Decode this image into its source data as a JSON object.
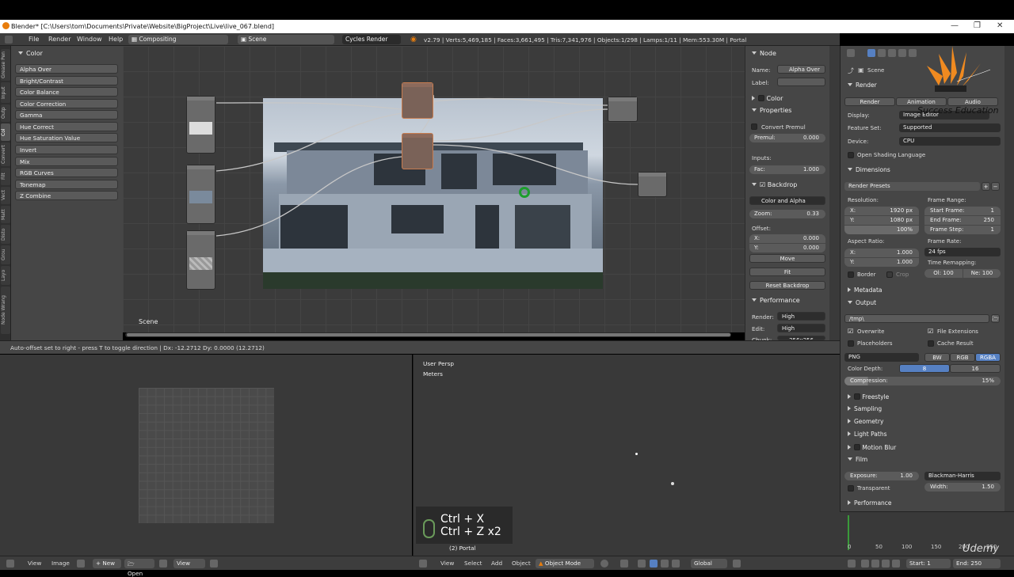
{
  "window": {
    "title": "Blender* [C:\\Users\\tom\\Documents\\Private\\Website\\BigProject\\Live\\live_067.blend]"
  },
  "mainmenu": {
    "items": [
      "File",
      "Render",
      "Window",
      "Help"
    ],
    "layout": "Compositing",
    "scene": "Scene",
    "engine": "Cycles Render",
    "stats": "v2.79 | Verts:5,469,185 | Faces:3,661,495 | Tris:7,341,976 | Objects:1/298 | Lamps:1/11 | Mem:553.30M | Portal"
  },
  "shelf": {
    "tabs": [
      "Grease Pen",
      "Input",
      "Outp",
      "Col",
      "Convert",
      "Filt",
      "Vect",
      "Matt",
      "Disto",
      "Grou",
      "Layo",
      "Node Wrang"
    ],
    "header": "Color",
    "buttons": [
      "Alpha Over",
      "Bright/Contrast",
      "Color Balance",
      "Color Correction",
      "Gamma",
      "Hue Correct",
      "Hue Saturation Value",
      "Invert",
      "Mix",
      "RGB Curves",
      "Tonemap",
      "Z Combine"
    ]
  },
  "nodeeditor": {
    "scene_label": "Scene"
  },
  "npanel": {
    "node_header": "Node",
    "name_label": "Name:",
    "name_value": "Alpha Over",
    "label_label": "Label:",
    "color_header": "Color",
    "properties_header": "Properties",
    "convert_premul": "Convert Premul",
    "premul": "Premul:",
    "premul_value": "0.000",
    "inputs": "Inputs:",
    "fac": "Fac:",
    "fac_value": "1.000",
    "backdrop_header": "Backdrop",
    "backdrop_mode": "Color and Alpha",
    "zoom": "Zoom:",
    "zoom_value": "0.33",
    "offset": "Offset:",
    "x": "X:",
    "x_value": "0.000",
    "y": "Y:",
    "y_value": "0.000",
    "move": "Move",
    "fit": "Fit",
    "reset": "Reset Backdrop",
    "performance_header": "Performance",
    "render": "Render:",
    "render_value": "High",
    "edit": "Edit:",
    "edit_value": "High",
    "chunk": "Chunk:",
    "chunk_value": "256x256"
  },
  "opstatus": {
    "text": "Auto-offset set to right - press T to toggle direction  |  Dx: -12.2712  Dy: 0.0000 (12.2712)"
  },
  "viewport": {
    "persp": "User Persp",
    "units": "Meters",
    "object": "(2) Portal"
  },
  "keys": {
    "line1": "Ctrl + X",
    "line2": "Ctrl + Z x2"
  },
  "bottombar": {
    "uv_items": [
      "View",
      "Image",
      "New",
      "Open",
      "View"
    ],
    "v3d_items": [
      "View",
      "Select",
      "Add",
      "Object"
    ],
    "mode": "Object Mode",
    "orientation": "Global"
  },
  "properties": {
    "scene": "Scene",
    "render_header": "Render",
    "render_btn": "Render",
    "animation_btn": "Animation",
    "audio_btn": "Audio",
    "display_label": "Display:",
    "display_value": "Image Editor",
    "feature_label": "Feature Set:",
    "feature_value": "Supported",
    "device_label": "Device:",
    "device_value": "CPU",
    "osl": "Open Shading Language",
    "dimensions_header": "Dimensions",
    "render_presets": "Render Presets",
    "resolution": "Resolution:",
    "res_x": "X:",
    "res_x_value": "1920 px",
    "res_y": "Y:",
    "res_y_value": "1080 px",
    "res_pct": "100%",
    "frame_range": "Frame Range:",
    "start_frame": "Start Frame:",
    "start_frame_value": "1",
    "end_frame": "End Frame:",
    "end_frame_value": "250",
    "frame_step": "Frame Step:",
    "frame_step_value": "1",
    "aspect": "Aspect Ratio:",
    "asp_x": "X:",
    "asp_x_value": "1.000",
    "asp_y": "Y:",
    "asp_y_value": "1.000",
    "frame_rate": "Frame Rate:",
    "fps": "24 fps",
    "time_remap": "Time Remapping:",
    "old": "Ol: 100",
    "new": "Ne: 100",
    "border": "Border",
    "crop": "Crop",
    "metadata_header": "Metadata",
    "output_header": "Output",
    "output_path": "/tmp\\",
    "overwrite": "Overwrite",
    "file_ext": "File Extensions",
    "placeholders": "Placeholders",
    "cache_result": "Cache Result",
    "format": "PNG",
    "bw": "BW",
    "rgb": "RGB",
    "rgba": "RGBA",
    "color_depth": "Color Depth:",
    "depth8": "8",
    "depth16": "16",
    "compression": "Compression:",
    "compression_value": "15%",
    "freestyle": "Freestyle",
    "sampling": "Sampling",
    "geometry": "Geometry",
    "light_paths": "Light Paths",
    "motion_blur": "Motion Blur",
    "film": "Film",
    "exposure": "Exposure:",
    "exposure_value": "1.00",
    "filter": "Blackman-Harris",
    "transparent": "Transparent",
    "width": "Width:",
    "width_value": "1.50",
    "performance": "Performance"
  },
  "timeline": {
    "ticks": [
      "0",
      "50",
      "100",
      "150",
      "200",
      "250"
    ],
    "start": "Start:",
    "start_value": "1",
    "end": "End:",
    "end_value": "250"
  },
  "watermark": {
    "logo": "Success Education",
    "udemy": "Udemy"
  },
  "colors": {
    "accent": "#5680c2",
    "blender_orange": "#e87d0d"
  }
}
